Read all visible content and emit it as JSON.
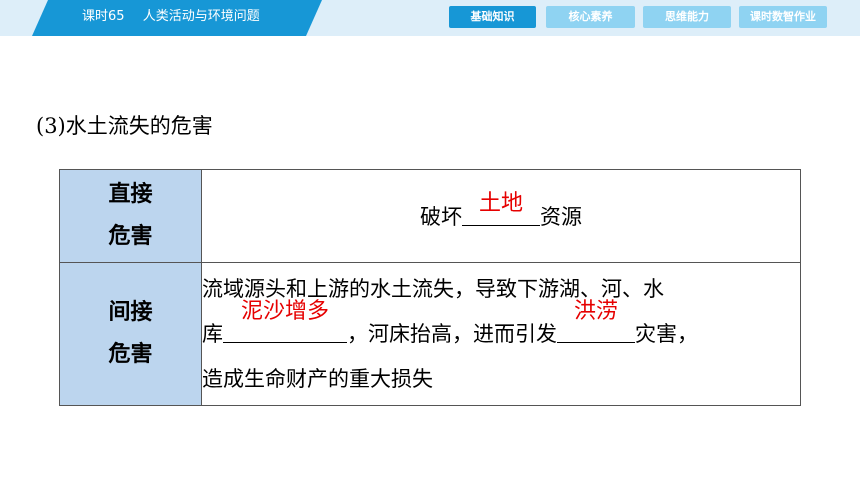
{
  "header": {
    "lesson": "课时65",
    "topic": "人类活动与环境问题"
  },
  "nav": {
    "items": [
      "基础知识",
      "核心素养",
      "思维能力",
      "课时数智作业"
    ],
    "active": "基础知识"
  },
  "section_title": "(3)水土流失的危害",
  "table": {
    "direct": {
      "header_line1": "直接",
      "header_line2": "危害",
      "prefix": "破坏",
      "answer": "土地",
      "suffix": "资源"
    },
    "indirect": {
      "header_line1": "间接",
      "header_line2": "危害",
      "line1": "流域源头和上游的水土流失，导致下游湖、河、水",
      "line2_prefix": "库",
      "answer1": "泥沙增多",
      "line2_mid": "，河床抬高，进而引发",
      "answer2": "洪涝",
      "line2_suffix": "灾害，",
      "line3": "造成生命财产的重大损失"
    }
  },
  "colors": {
    "accent": "#1797d6",
    "answer": "#e60000",
    "header_cell": "#bcd5ee"
  }
}
